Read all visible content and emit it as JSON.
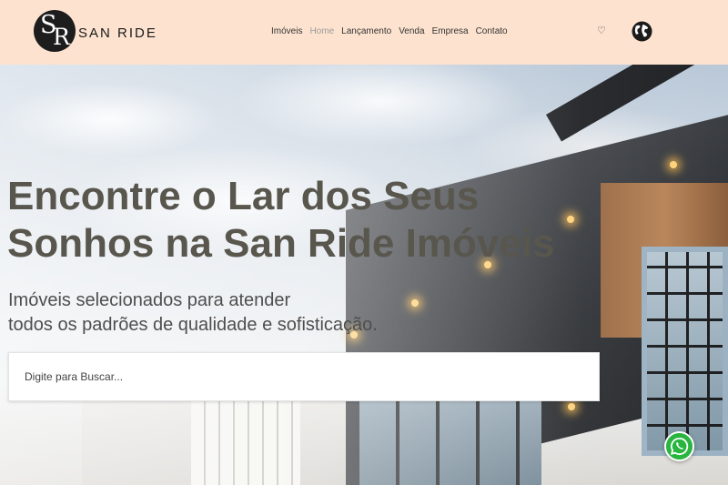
{
  "header": {
    "logo_letters": "SR",
    "brand": "SAN RIDE",
    "nav": [
      "Imóveis",
      "Home",
      "Lançamento",
      "Venda",
      "Empresa",
      "Contato"
    ],
    "active_nav": "Home",
    "favorites_icon": "heart-icon",
    "language_icon": "globe-icon",
    "background_color": "#fde3cf"
  },
  "hero": {
    "title_line1": "Encontre o Lar dos Seus",
    "title_line2": "Sonhos na San Ride Imóveis",
    "subtitle_line1": "Imóveis selecionados para atender",
    "subtitle_line2": "todos os padrões de qualidade e sofisticação.",
    "search_placeholder": "Digite para Buscar...",
    "title_color": "#58564d"
  },
  "floating": {
    "whatsapp_icon": "whatsapp-icon",
    "whatsapp_color": "#2ab540"
  }
}
